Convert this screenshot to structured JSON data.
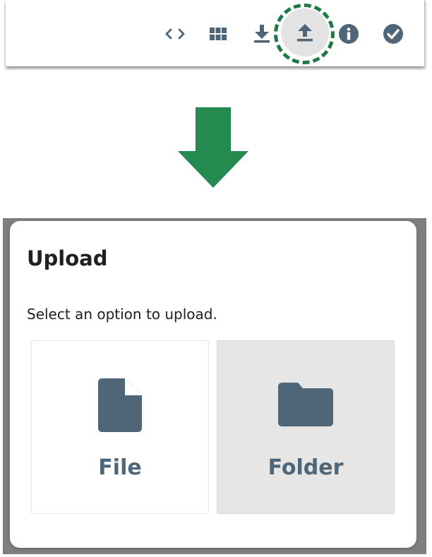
{
  "colors": {
    "icon": "#4e6677",
    "highlight_ring": "#1e7a44",
    "arrow": "#248a4f",
    "dialog_backdrop": "#7f7f7f",
    "selected_option_bg": "#e6e6e6"
  },
  "toolbar": {
    "buttons": [
      {
        "name": "code-icon"
      },
      {
        "name": "grid-icon"
      },
      {
        "name": "download-icon"
      },
      {
        "name": "upload-icon",
        "highlighted": true
      },
      {
        "name": "info-icon"
      },
      {
        "name": "check-circle-icon"
      }
    ]
  },
  "annotation": {
    "arrow_icon": "arrow-down-icon"
  },
  "dialog": {
    "title": "Upload",
    "subtitle": "Select an option to upload.",
    "options": [
      {
        "label": "File",
        "icon": "file-icon"
      },
      {
        "label": "Folder",
        "icon": "folder-icon",
        "selected": true
      }
    ]
  }
}
